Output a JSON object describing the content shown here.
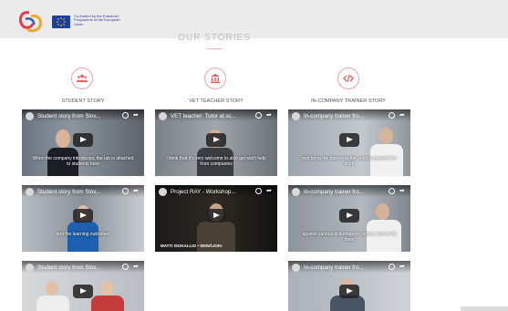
{
  "header": {
    "eu_text": "Co-funded by the Erasmus+ Programme of the European Union"
  },
  "section": {
    "title": "OUR STORIES"
  },
  "columns": [
    {
      "label": "STUDENT STORY",
      "icon": "group-icon"
    },
    {
      "label": "VET TEACHER STORY",
      "icon": "institution-icon"
    },
    {
      "label": "IN-COMPANY TRAINER STORY",
      "icon": "code-icon"
    }
  ],
  "videos": {
    "s1": {
      "title": "Student story from Slov...",
      "caption": "When the company introduces, the lab is attached to students here"
    },
    "s2": {
      "title": "Student story from Slov...",
      "caption": "and the learning outcomes"
    },
    "s3": {
      "title": "Student story from Slov...",
      "caption": ""
    },
    "t1": {
      "title": "VET teacher: Tutor at sc...",
      "caption": "I think that it's very welcome to also get such help from companies"
    },
    "t2": {
      "title": "Project RAY - Workshop...",
      "caption": "",
      "nameplate": "MATTI ISOKALLIO • SEINÄJOKI"
    },
    "c1": {
      "title": "In-company trainer fro...",
      "caption": "and bring the trainee to the point to present the work"
    },
    "c2": {
      "title": "In-company trainer fro...",
      "caption": "against various disturbances, errors, how to fix them"
    },
    "c3": {
      "title": "In-company trainer fro...",
      "caption": ""
    }
  },
  "colors": {
    "accent": "#e85a5a",
    "icon_ring": "#f2a3a3"
  }
}
